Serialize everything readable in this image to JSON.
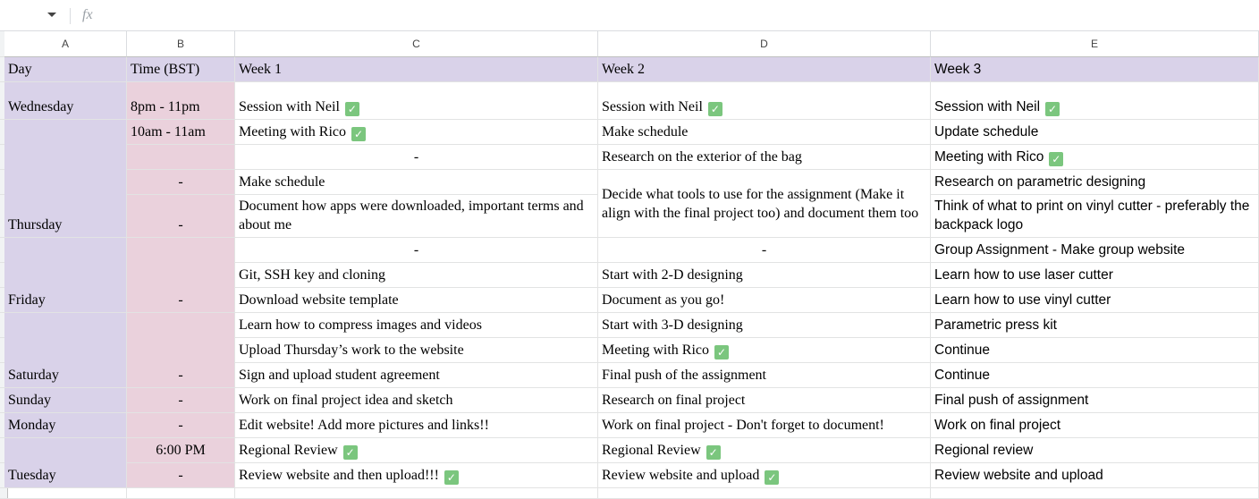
{
  "formula_bar": {
    "fx_label": "fx"
  },
  "column_letters": [
    "A",
    "B",
    "C",
    "D",
    "E"
  ],
  "header": {
    "day": "Day",
    "time": "Time (BST)",
    "week1": "Week 1",
    "week2": "Week 2",
    "week3": "Week 3"
  },
  "days": [
    "Wednesday",
    "Thursday",
    "Friday",
    "Saturday",
    "Sunday",
    "Monday",
    "Tuesday"
  ],
  "times": [
    "8pm - 11pm",
    "10am - 11am",
    "",
    "-",
    "-",
    "-",
    "-",
    "-",
    "-",
    "6:00 PM",
    "-"
  ],
  "week1": [
    {
      "text": "Session with Neil",
      "done": true
    },
    {
      "text": "Meeting with Rico",
      "done": true
    },
    {
      "text": "-",
      "done": false
    },
    {
      "text": "Make schedule",
      "done": false
    },
    {
      "text": "Document how apps were downloaded, important terms and about me",
      "done": false
    },
    {
      "text": "-",
      "done": false
    },
    {
      "text": "Git, SSH key and cloning",
      "done": false
    },
    {
      "text": "Download website template",
      "done": false
    },
    {
      "text": "Learn how to compress images and videos",
      "done": false
    },
    {
      "text": "Upload Thursday’s work to the website",
      "done": false
    },
    {
      "text": "Sign and upload student agreement",
      "done": false
    },
    {
      "text": "Work on final project idea and sketch",
      "done": false
    },
    {
      "text": "Edit website! Add more pictures and links!!",
      "done": false
    },
    {
      "text": "Regional Review",
      "done": true
    },
    {
      "text": "Review website and then upload!!!",
      "done": true
    }
  ],
  "week2": [
    {
      "text": "Session with Neil",
      "done": true
    },
    {
      "text": "Make schedule",
      "done": false
    },
    {
      "text": "Research on the exterior of the bag",
      "done": false
    },
    {
      "text": "Decide what tools to use for the assignment (Make it align with the final project too) and document them too",
      "done": false
    },
    {
      "text": "-",
      "done": false
    },
    {
      "text": "Start with 2-D designing",
      "done": false
    },
    {
      "text": "Document as you go!",
      "done": false
    },
    {
      "text": "Start with 3-D designing",
      "done": false
    },
    {
      "text": "Meeting with Rico",
      "done": true
    },
    {
      "text": "Final push of the assignment",
      "done": false
    },
    {
      "text": "Research on final project",
      "done": false
    },
    {
      "text": "Work on final project - Don't forget to document!",
      "done": false
    },
    {
      "text": "Regional Review",
      "done": true
    },
    {
      "text": "Review website and upload",
      "done": true
    }
  ],
  "week3": [
    {
      "text": "Session with Neil",
      "done": true
    },
    {
      "text": "Update schedule",
      "done": false
    },
    {
      "text": "Meeting with Rico",
      "done": true
    },
    {
      "text": "Research on parametric designing",
      "done": false
    },
    {
      "text": "Think of what to print on vinyl cutter - preferably the backpack logo",
      "done": false
    },
    {
      "text": "Group Assignment - Make group website",
      "done": false
    },
    {
      "text": "Learn how to use laser cutter",
      "done": false
    },
    {
      "text": "Learn how to use vinyl cutter",
      "done": false
    },
    {
      "text": "Parametric press kit",
      "done": false
    },
    {
      "text": "Continue",
      "done": false
    },
    {
      "text": "Continue",
      "done": false
    },
    {
      "text": "Final push of assignment",
      "done": false
    },
    {
      "text": "Work on final project",
      "done": false
    },
    {
      "text": "Regional review",
      "done": false
    },
    {
      "text": "Review website and upload",
      "done": false
    }
  ],
  "colors": {
    "day_bg": "#d9d2e9",
    "time_bg": "#ead1dc",
    "check": "#7bc67e"
  }
}
